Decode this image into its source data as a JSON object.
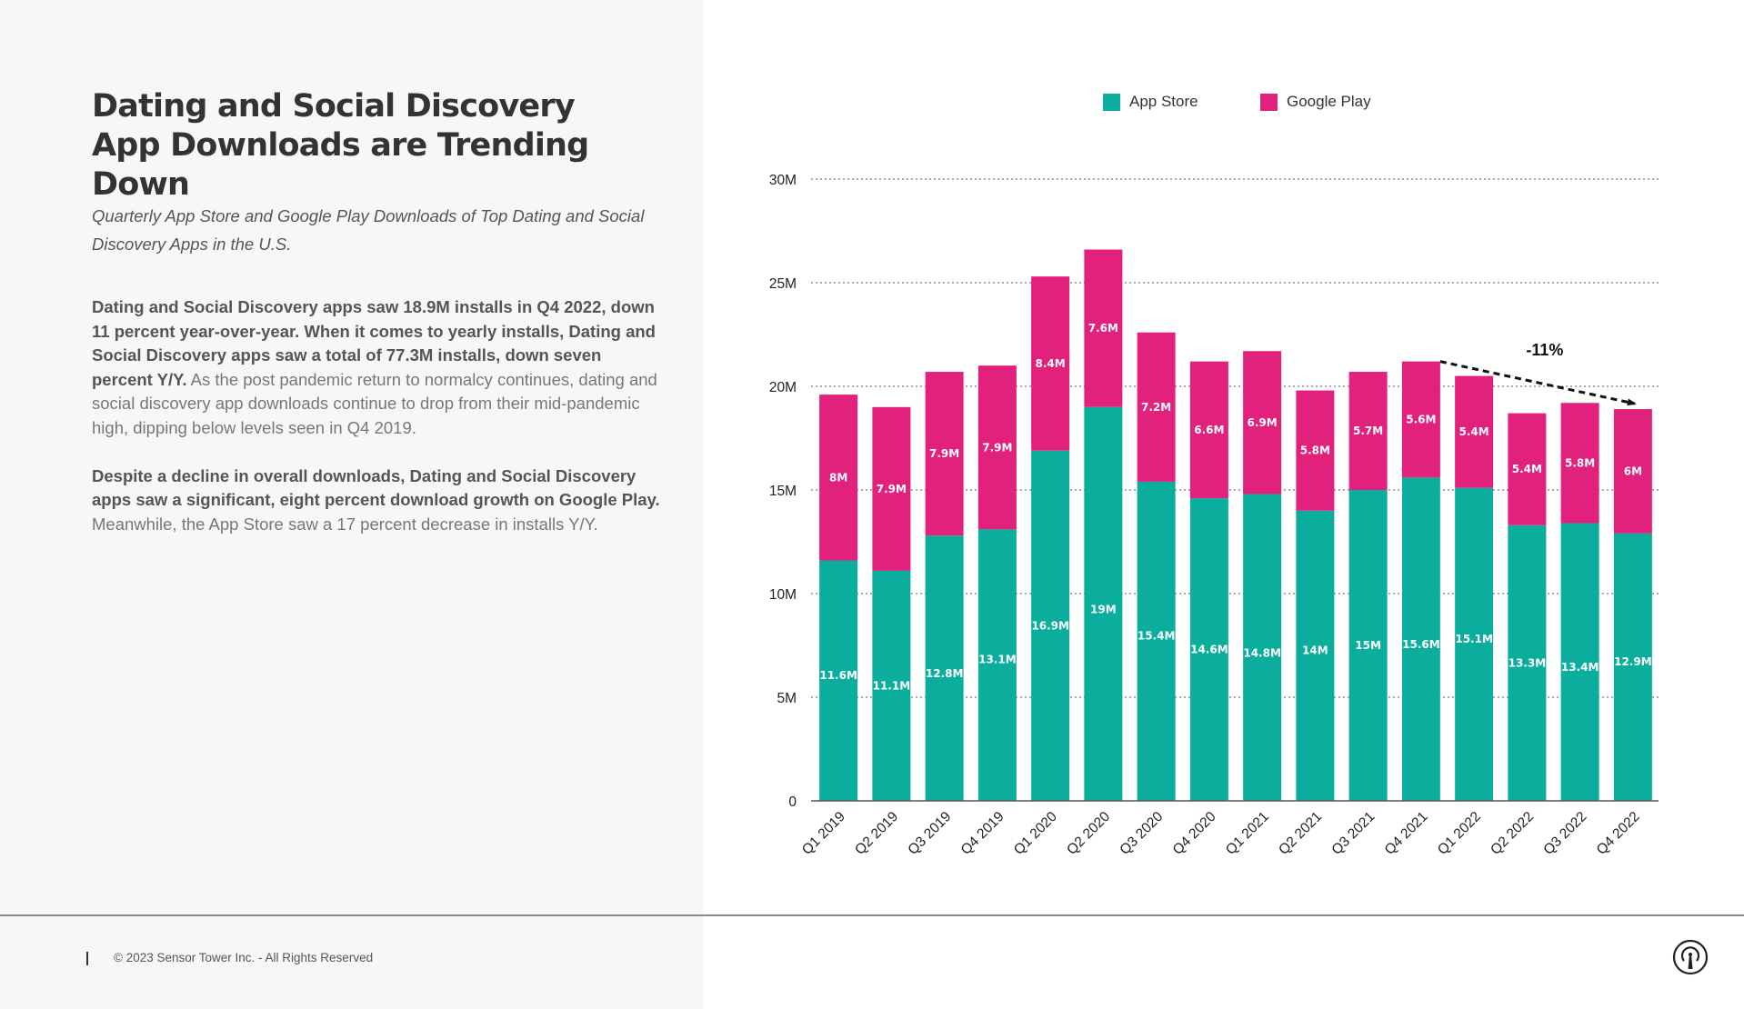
{
  "page": {
    "title": "Dating and Social Discovery App Downloads are Trending Down",
    "subtitle": "Quarterly App Store and Google Play Downloads of Top Dating and Social Discovery Apps in the U.S.",
    "paragraphs": [
      {
        "bold": "Dating and Social Discovery apps saw 18.9M installs in Q4 2022, down 11 percent year-over-year. When it comes to yearly installs, Dating and Social Discovery apps saw a total of 77.3M installs, down seven percent Y/Y.",
        "regular": " As the post pandemic return to normalcy continues, dating and social discovery app downloads continue to drop from their mid-pandemic high, dipping below levels seen in Q4 2019."
      },
      {
        "bold": "Despite a decline in overall downloads, Dating and Social Discovery apps saw a significant, eight percent download growth on Google Play.",
        "regular": " Meanwhile, the App Store saw a 17 percent decrease in installs Y/Y."
      }
    ],
    "footer": "© 2023 Sensor Tower Inc. - All Rights Reserved",
    "logo_icon": "sensor-tower-logo-icon"
  },
  "colors": {
    "app_store": "#0bae9d",
    "google_play": "#e2217c",
    "gridline": "#aaaaaa",
    "axis": "#555555"
  },
  "chart_data": {
    "type": "bar",
    "stacked": true,
    "title": "",
    "xlabel": "",
    "ylabel": "",
    "ylim": [
      0,
      30
    ],
    "y_unit": "M",
    "yticks": [
      {
        "value": 0,
        "label": "0"
      },
      {
        "value": 5,
        "label": "5M"
      },
      {
        "value": 10,
        "label": "10M"
      },
      {
        "value": 15,
        "label": "15M"
      },
      {
        "value": 20,
        "label": "20M"
      },
      {
        "value": 25,
        "label": "25M"
      },
      {
        "value": 30,
        "label": "30M"
      }
    ],
    "grid": true,
    "legend_position": "top-center",
    "categories": [
      "Q1 2019",
      "Q2 2019",
      "Q3 2019",
      "Q4 2019",
      "Q1 2020",
      "Q2 2020",
      "Q3 2020",
      "Q4 2020",
      "Q1 2021",
      "Q2 2021",
      "Q3 2021",
      "Q4 2021",
      "Q1 2022",
      "Q2 2022",
      "Q3 2022",
      "Q4 2022"
    ],
    "series": [
      {
        "name": "App Store",
        "values": [
          11.6,
          11.1,
          12.8,
          13.1,
          16.9,
          19,
          15.4,
          14.6,
          14.8,
          14,
          15,
          15.6,
          15.1,
          13.3,
          13.4,
          12.9
        ],
        "labels": [
          "11.6M",
          "11.1M",
          "12.8M",
          "13.1M",
          "16.9M",
          "19M",
          "15.4M",
          "14.6M",
          "14.8M",
          "14M",
          "15M",
          "15.6M",
          "15.1M",
          "13.3M",
          "13.4M",
          "12.9M"
        ]
      },
      {
        "name": "Google Play",
        "values": [
          8,
          7.9,
          7.9,
          7.9,
          8.4,
          7.6,
          7.2,
          6.6,
          6.9,
          5.8,
          5.7,
          5.6,
          5.4,
          5.4,
          5.8,
          6
        ],
        "labels": [
          "8M",
          "7.9M",
          "7.9M",
          "7.9M",
          "8.4M",
          "7.6M",
          "7.2M",
          "6.6M",
          "6.9M",
          "5.8M",
          "5.7M",
          "5.6M",
          "5.4M",
          "5.4M",
          "5.8M",
          "6M"
        ]
      }
    ],
    "annotations": [
      {
        "type": "dashed-arrow",
        "from_category": "Q4 2021",
        "to_category": "Q4 2022",
        "label": "-11%"
      }
    ]
  }
}
